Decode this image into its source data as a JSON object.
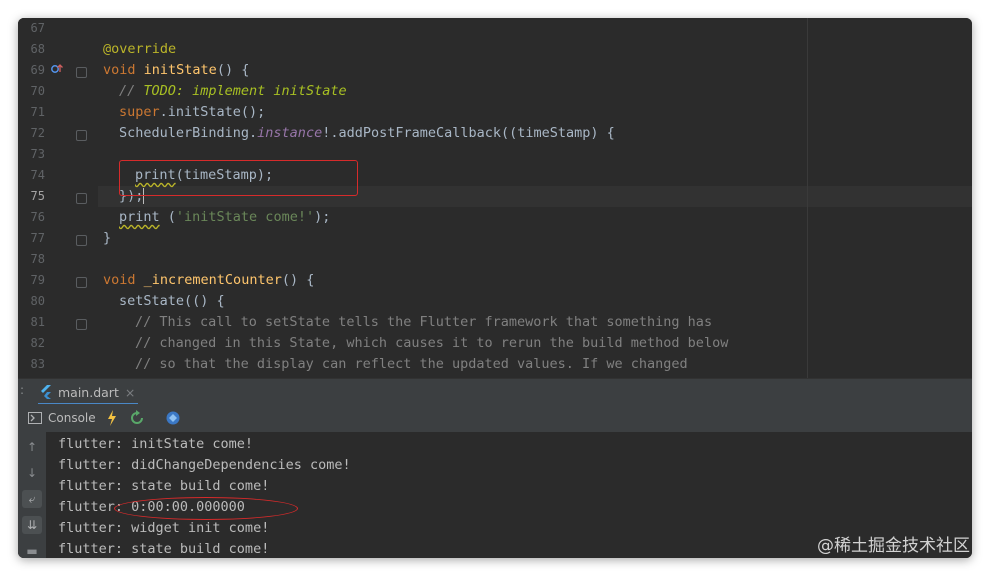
{
  "editor": {
    "lines": [
      {
        "no": "67"
      },
      {
        "no": "68"
      },
      {
        "no": "69"
      },
      {
        "no": "70"
      },
      {
        "no": "71"
      },
      {
        "no": "72"
      },
      {
        "no": "73"
      },
      {
        "no": "74"
      },
      {
        "no": "75"
      },
      {
        "no": "76"
      },
      {
        "no": "77"
      },
      {
        "no": "78"
      },
      {
        "no": "79"
      },
      {
        "no": "80"
      },
      {
        "no": "81"
      },
      {
        "no": "82"
      },
      {
        "no": "83"
      }
    ],
    "tokens": {
      "override": "@override",
      "void": "void",
      "initState": "initState",
      "initState_tail": "() {",
      "todo_slashes": "// ",
      "todo_text": "TODO: implement initState",
      "super": "super",
      "super_tail": ".initState();",
      "scheduler_a": "SchedulerBinding.",
      "scheduler_instance": "instance",
      "scheduler_b": "!.addPostFrameCallback((timeStamp) {",
      "print_kw": "print",
      "print_tail": "(timeStamp);",
      "close_cb": "});",
      "print2_kw": "print",
      "print2_a": " (",
      "print2_str": "'initState come!'",
      "print2_b": ");",
      "brace_close": "}",
      "void2": "void",
      "incr": "_incrementCounter",
      "incr_tail": "() {",
      "setState": "setState(() {",
      "c81": "// This call to setState tells the Flutter framework that something has",
      "c82": "// changed in this State, which causes it to rerun the build method below",
      "c83": "// so that the display can reflect the updated values. If we changed"
    }
  },
  "run_tab": {
    "file": "main.dart",
    "close": "×"
  },
  "toolbar": {
    "console_label": "Console"
  },
  "console": {
    "lines": [
      "flutter: initState come!",
      "flutter: didChangeDependencies come!",
      "flutter: state build come!",
      "flutter: 0:00:00.000000",
      "flutter: widget init come!",
      "flutter: state build come!"
    ]
  },
  "watermark": "@稀土掘金技术社区",
  "colors": {
    "highlight": "#d62b2b",
    "keyword": "#cc7832",
    "function": "#ffc66d",
    "string": "#6a8759"
  }
}
